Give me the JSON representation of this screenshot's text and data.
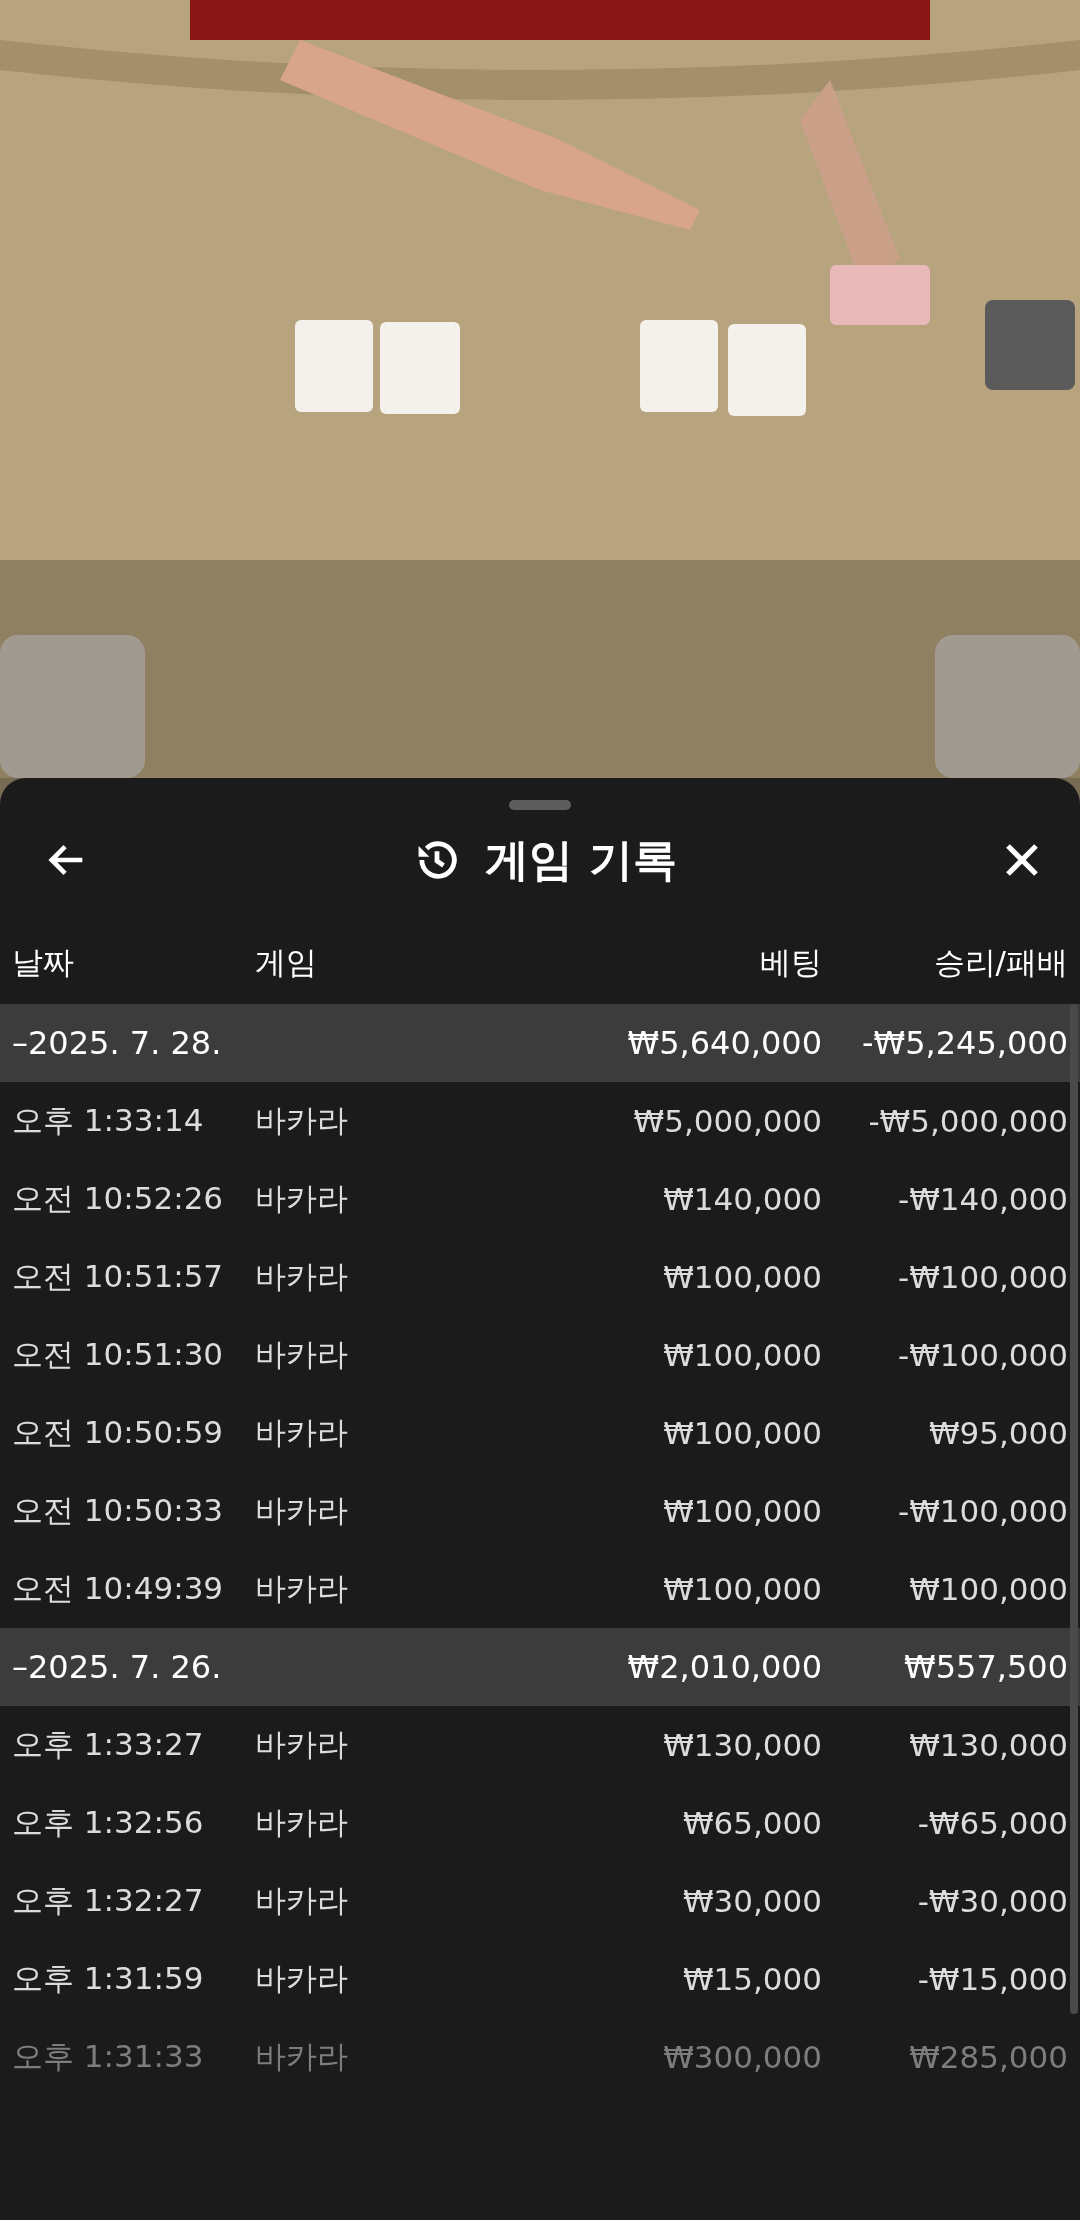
{
  "sheet": {
    "title": "게임 기록"
  },
  "table": {
    "columns": [
      "날짜",
      "게임",
      "베팅",
      "승리/패배"
    ],
    "groups": [
      {
        "date": "–2025. 7. 28.",
        "bet": "₩5,640,000",
        "result": "-₩5,245,000",
        "rows": [
          {
            "time": "오후 1:33:14",
            "game": "바카라",
            "bet": "₩5,000,000",
            "result": "-₩5,000,000",
            "faded": false
          },
          {
            "time": "오전 10:52:26",
            "game": "바카라",
            "bet": "₩140,000",
            "result": "-₩140,000",
            "faded": false
          },
          {
            "time": "오전 10:51:57",
            "game": "바카라",
            "bet": "₩100,000",
            "result": "-₩100,000",
            "faded": false
          },
          {
            "time": "오전 10:51:30",
            "game": "바카라",
            "bet": "₩100,000",
            "result": "-₩100,000",
            "faded": false
          },
          {
            "time": "오전 10:50:59",
            "game": "바카라",
            "bet": "₩100,000",
            "result": "₩95,000",
            "faded": false
          },
          {
            "time": "오전 10:50:33",
            "game": "바카라",
            "bet": "₩100,000",
            "result": "-₩100,000",
            "faded": false
          },
          {
            "time": "오전 10:49:39",
            "game": "바카라",
            "bet": "₩100,000",
            "result": "₩100,000",
            "faded": false
          }
        ]
      },
      {
        "date": "–2025. 7. 26.",
        "bet": "₩2,010,000",
        "result": "₩557,500",
        "rows": [
          {
            "time": "오후 1:33:27",
            "game": "바카라",
            "bet": "₩130,000",
            "result": "₩130,000",
            "faded": false
          },
          {
            "time": "오후 1:32:56",
            "game": "바카라",
            "bet": "₩65,000",
            "result": "-₩65,000",
            "faded": false
          },
          {
            "time": "오후 1:32:27",
            "game": "바카라",
            "bet": "₩30,000",
            "result": "-₩30,000",
            "faded": false
          },
          {
            "time": "오후 1:31:59",
            "game": "바카라",
            "bet": "₩15,000",
            "result": "-₩15,000",
            "faded": false
          },
          {
            "time": "오후 1:31:33",
            "game": "바카라",
            "bet": "₩300,000",
            "result": "₩285,000",
            "faded": true
          }
        ]
      }
    ]
  }
}
